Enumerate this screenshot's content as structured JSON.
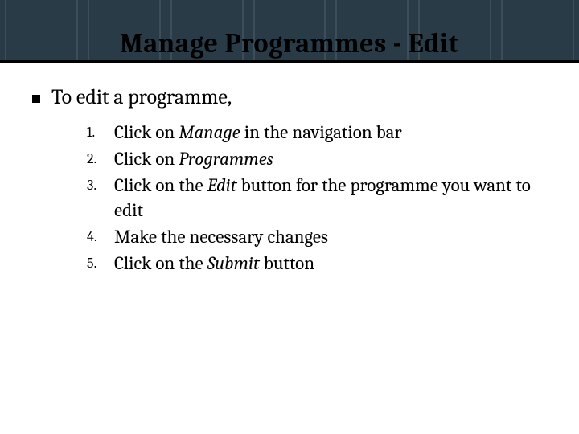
{
  "header": {
    "title": "Manage Programmes - Edit"
  },
  "lead": "To edit a programme,",
  "steps": {
    "s1a": "Click on ",
    "s1b": "Manage",
    "s1c": " in the navigation bar",
    "s2a": "Click on ",
    "s2b": "Programmes",
    "s3a": "Click on the ",
    "s3b": "Edit",
    "s3c": " button for the programme you want to edit",
    "s4": "Make the necessary changes",
    "s5a": "Click on the ",
    "s5b": "Submit",
    "s5c": " button"
  }
}
